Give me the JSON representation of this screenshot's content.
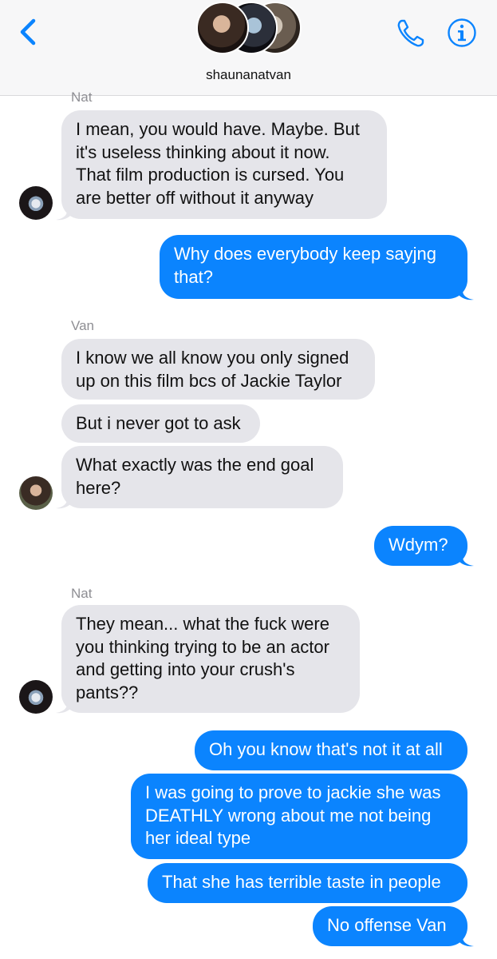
{
  "header": {
    "group_name": "shaunanatvan",
    "accent": "#0b84fe"
  },
  "icons": {
    "back": "chevron-left-icon",
    "call": "phone-icon",
    "info": "info-icon"
  },
  "colors": {
    "incoming_bubble": "#e5e5ea",
    "outgoing_bubble": "#0b84fe"
  },
  "messages": {
    "sender_nat_top": "Nat",
    "m1_l1": "I mean, you would have. Maybe. But",
    "m1_l2": "it's useless thinking about it now.",
    "m1_l3": "That film production is cursed. You",
    "m1_l4": "are better off without it anyway",
    "m2_l1": "Why does everybody keep sayjng",
    "m2_l2": "that?",
    "sender_van": "Van",
    "m3_l1": "I know we all know you only signed",
    "m3_l2": "up on this film bcs of Jackie Taylor",
    "m4": "But i never got to ask",
    "m5_l1": "What exactly was the end goal",
    "m5_l2": "here?",
    "m6": "Wdym?",
    "sender_nat": "Nat",
    "m7_l1": "They mean... what the fuck were",
    "m7_l2": "you thinking trying to be an actor",
    "m7_l3": "and getting into your crush's",
    "m7_l4": "pants??",
    "m8": "Oh you know that's not it at all",
    "m9_l1": "I was going to prove to jackie she was",
    "m9_l2": "DEATHLY wrong about me not being",
    "m9_l3": "her ideal type",
    "m10": "That she has terrible taste in people",
    "m11": "No offense Van"
  }
}
